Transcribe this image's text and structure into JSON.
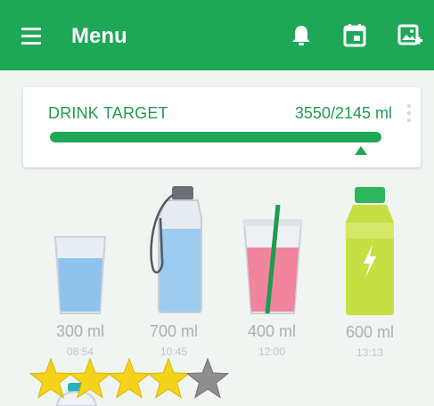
{
  "appbar": {
    "title": "Menu",
    "menu_icon": "hamburger-icon",
    "actions": [
      "bell-icon",
      "calendar-icon",
      "add-photo-icon"
    ],
    "color": "#1fa758"
  },
  "target": {
    "label": "DRINK TARGET",
    "amount": "3550/2145 ml",
    "progress": 1.0
  },
  "drinks": [
    {
      "name": "glass-of-water",
      "amount": "300 ml",
      "time": "08:54"
    },
    {
      "name": "water-bottle",
      "amount": "700 ml",
      "time": "10:45"
    },
    {
      "name": "pink-drink-cup",
      "amount": "400 ml",
      "time": "12:00"
    },
    {
      "name": "sports-drink-bottle",
      "amount": "600 ml",
      "time": "13:13"
    }
  ],
  "rating": {
    "filled": 4,
    "total": 5
  }
}
